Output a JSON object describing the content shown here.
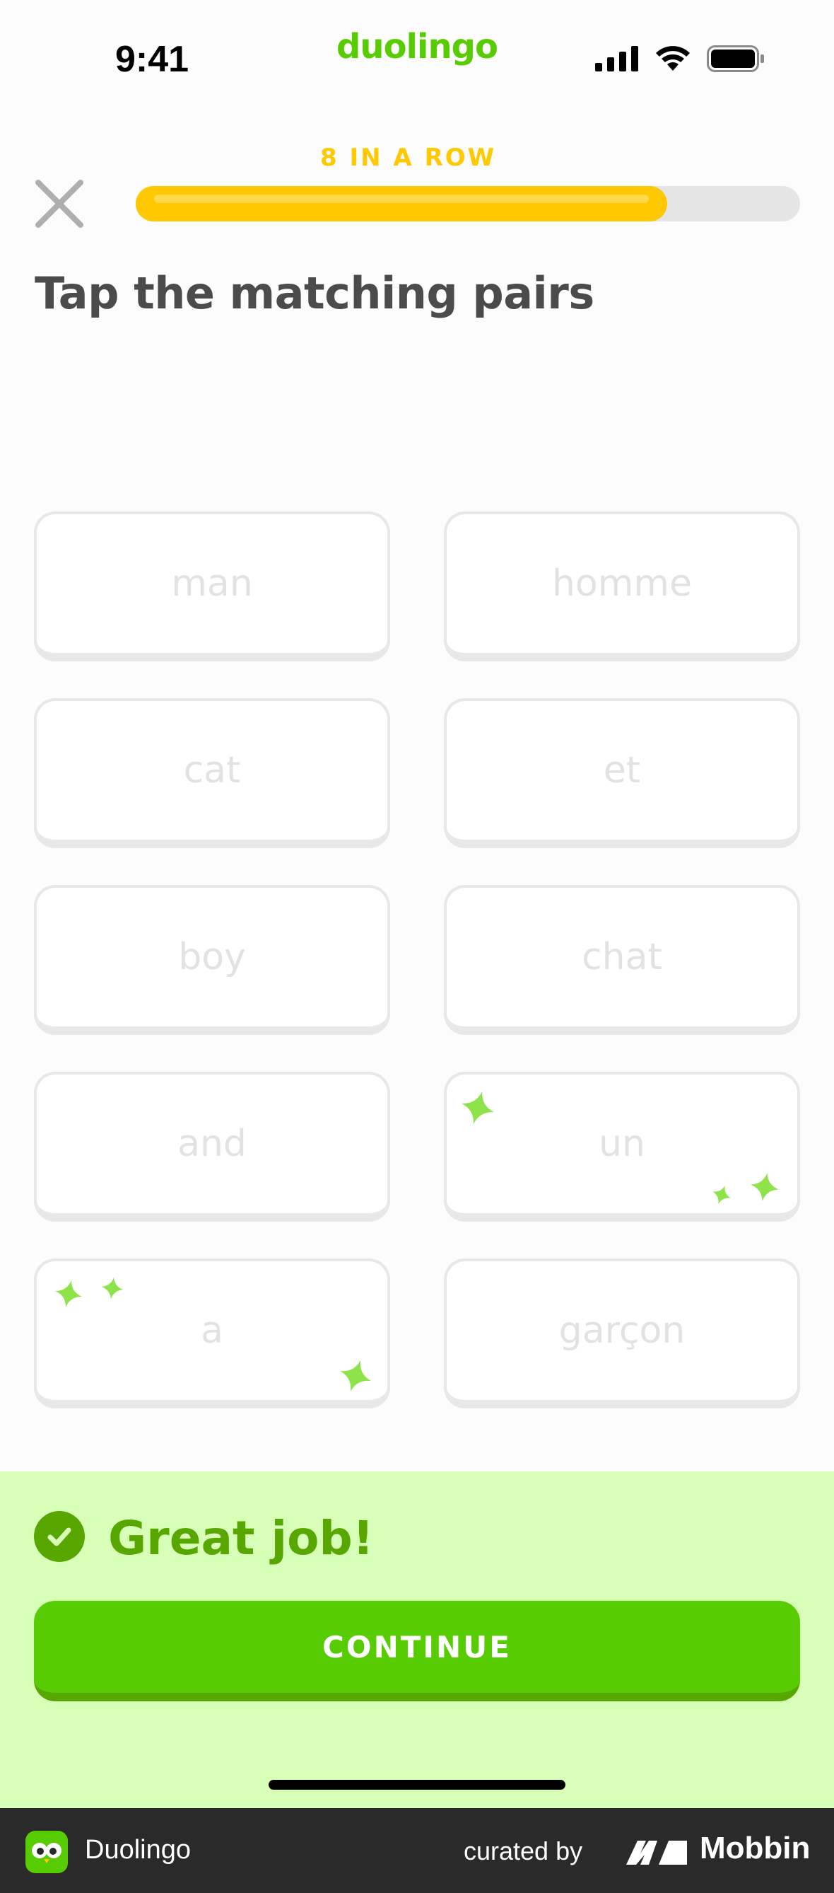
{
  "status_bar": {
    "time": "9:41",
    "brand": "duolingo"
  },
  "header": {
    "streak_label": "8 IN A ROW",
    "progress_fraction": 0.8
  },
  "prompt": "Tap the matching pairs",
  "tiles": {
    "left": [
      "man",
      "cat",
      "boy",
      "and",
      "a"
    ],
    "right": [
      "homme",
      "et",
      "chat",
      "un",
      "garçon"
    ]
  },
  "feedback": {
    "message": "Great job!",
    "continue_label": "CONTINUE"
  },
  "banner": {
    "app_name": "Duolingo",
    "curated_by": "curated by",
    "mobbin": "Mobbin"
  },
  "colors": {
    "accent_green": "#58cc02",
    "dark_green": "#58a700",
    "feedback_bg": "#d7ffb8",
    "streak_gold": "#ffc800",
    "spark_green": "#8fe34a"
  }
}
